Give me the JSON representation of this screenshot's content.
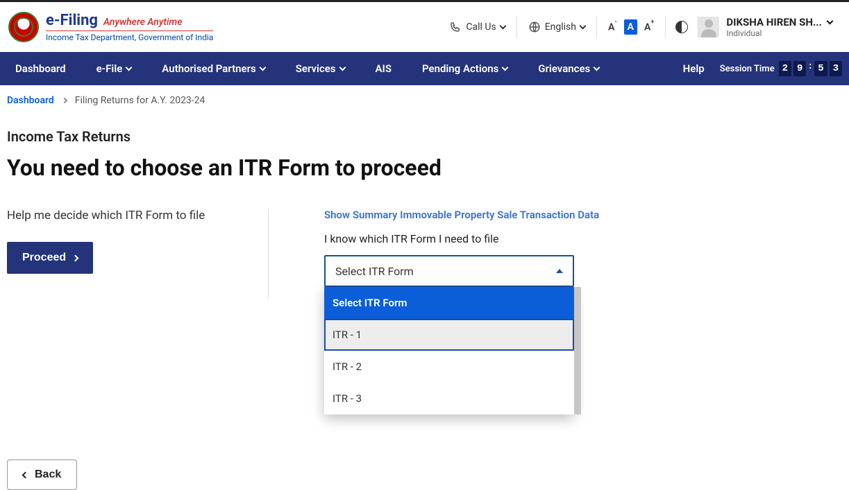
{
  "app": {
    "name": "e-Filing",
    "tagline": "Anywhere Anytime",
    "subline": "Income Tax Department, Government of India"
  },
  "header": {
    "call_us": "Call Us",
    "language": "English",
    "font_minus": "A",
    "font_normal": "A",
    "font_plus": "A",
    "user_name": "DIKSHA HIREN SH...",
    "user_type": "Individual"
  },
  "nav": {
    "dashboard": "Dashboard",
    "efile": "e-File",
    "authorised": "Authorised Partners",
    "services": "Services",
    "ais": "AIS",
    "pending": "Pending Actions",
    "grievances": "Grievances",
    "help": "Help",
    "session_label": "Session Time",
    "session_digits": [
      "2",
      "9",
      "5",
      "3"
    ]
  },
  "breadcrumbs": {
    "root": "Dashboard",
    "current": "Filing Returns for A.Y. 2023-24"
  },
  "page": {
    "kicker": "Income Tax Returns",
    "title": "You need to choose an ITR Form to proceed",
    "help_me": "Help me decide which ITR Form to file",
    "proceed": "Proceed",
    "summary_link": "Show Summary Immovable Property Sale Transaction Data",
    "i_know": "I know which ITR Form I need to file",
    "select_placeholder": "Select ITR Form",
    "back": "Back"
  },
  "dropdown": {
    "head": "Select ITR Form",
    "items": [
      "ITR - 1",
      "ITR - 2",
      "ITR - 3"
    ]
  }
}
